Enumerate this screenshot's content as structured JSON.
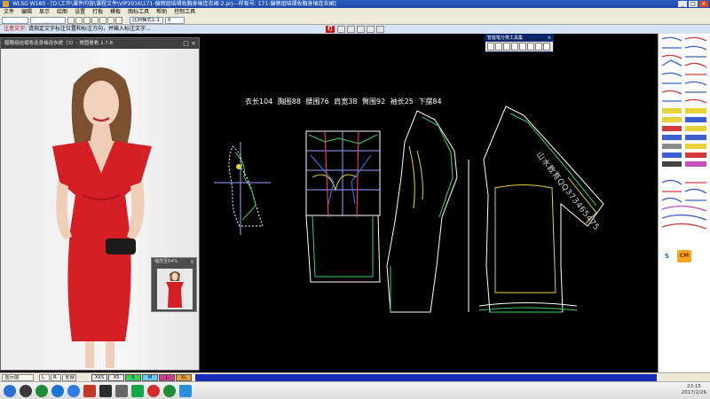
{
  "title_bar": {
    "title": "WLSG W180 - [D:\\工作\\课件内容\\课程文件\\VIP2016\\171-偏侧组结褶收胸身袖连衣裙-2.prj---样板号: 171-偏侧组结褶收胸身袖连衣裙]",
    "minimize": "_",
    "maximize": "□",
    "close": "×"
  },
  "menu": {
    "items": [
      "文件",
      "编辑",
      "显示",
      "绘图",
      "设置",
      "打板",
      "模板",
      "图标工具",
      "帮助",
      "控制工具"
    ]
  },
  "toolbar": {
    "combo_1": "",
    "combo_2": "",
    "zoom_value": "0",
    "mode_value": "比例模式1:1"
  },
  "notice": {
    "label": "注意文字:",
    "text": "请指定文字标注位置和标注方向，并输入标注文字...",
    "print_label": "打"
  },
  "viewer": {
    "title": "醋酸组结褶收连身袖连衣裙（3）- 美图看看 2.7.8",
    "controls": "□ ×",
    "thumbnail": {
      "title": "缩放至64%",
      "close": "×"
    }
  },
  "toolbox": {
    "title": "智能笔分类工具集",
    "close": "×"
  },
  "canvas": {
    "measurements": "衣长104  胸围88  腰围76  肩宽38  臀围92  袖长25  下摆84",
    "watermark": "山水教育QQ373465475"
  },
  "palette": {
    "cm_label": "CM",
    "s_label": "S"
  },
  "status_bar": {
    "display_layer": "显示层",
    "cells": [
      "L",
      "R",
      "全部"
    ],
    "size_labels": [
      "XXS",
      "XS",
      "S",
      "M",
      "L",
      "XL"
    ]
  },
  "taskbar": {
    "time": "23:15",
    "date": "2017/2/26"
  },
  "colors": {
    "title_bar": "#1c47a4",
    "dress_red": "#d41f24",
    "pattern_green": "#39d35a",
    "pattern_yellow": "#e8d23c"
  }
}
